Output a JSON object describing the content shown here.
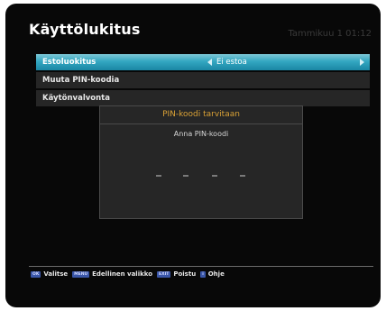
{
  "header": {
    "title": "Käyttölukitus",
    "clock": "Tammikuu 1 01:12"
  },
  "menu": {
    "items": [
      {
        "label": "Estoluokitus",
        "value": "Ei estoa"
      },
      {
        "label": "Muuta PIN-koodia"
      },
      {
        "label": "Käytönvalvonta"
      }
    ]
  },
  "dialog": {
    "title": "PIN-koodi tarvitaan",
    "prompt": "Anna PIN-koodi",
    "pin_digits": 4
  },
  "footer": {
    "items": [
      {
        "key": "OK",
        "label": "Valitse"
      },
      {
        "key": "MENU",
        "label": "Edellinen valikko"
      },
      {
        "key": "EXIT",
        "label": "Poistu"
      },
      {
        "key": "i",
        "label": "Ohje"
      }
    ]
  },
  "colors": {
    "accent": "#33a7c1",
    "dialog_title": "#d9a136",
    "key": "#3a56a8"
  }
}
